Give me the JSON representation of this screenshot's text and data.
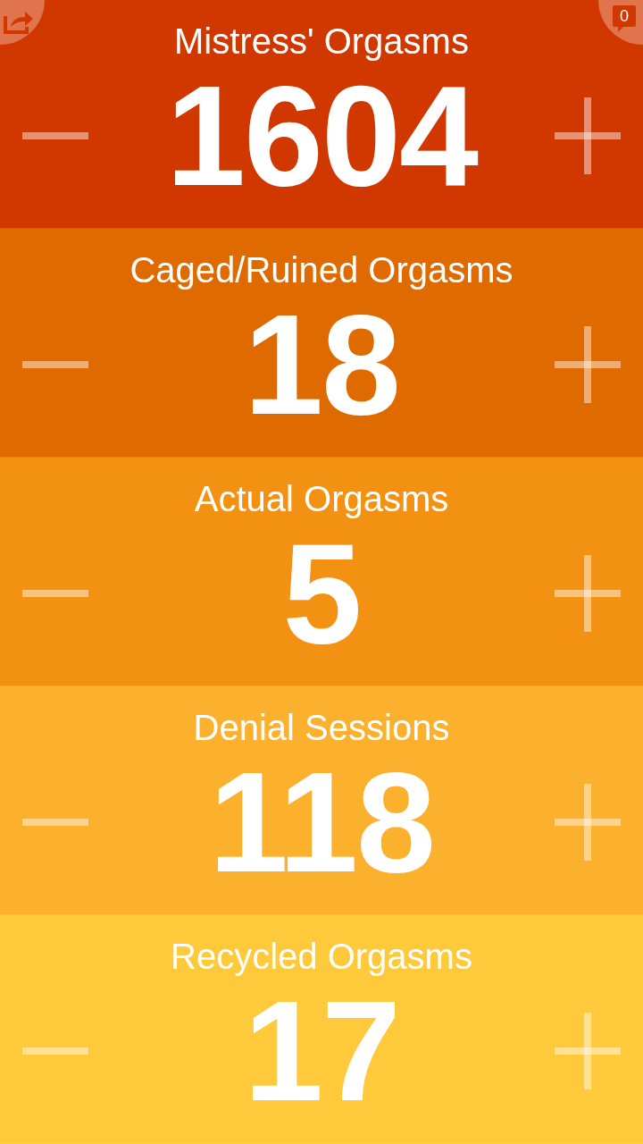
{
  "comment_badge": {
    "count": "0"
  },
  "counters": [
    {
      "title": "Mistress' Orgasms",
      "value": "1604",
      "color": "#d13800"
    },
    {
      "title": "Caged/Ruined Orgasms",
      "value": "18",
      "color": "#de6a00"
    },
    {
      "title": "Actual Orgasms",
      "value": "5",
      "color": "#f39212"
    },
    {
      "title": "Denial Sessions",
      "value": "118",
      "color": "#fbb02e"
    },
    {
      "title": "Recycled Orgasms",
      "value": "17",
      "color": "#fec93a"
    }
  ]
}
